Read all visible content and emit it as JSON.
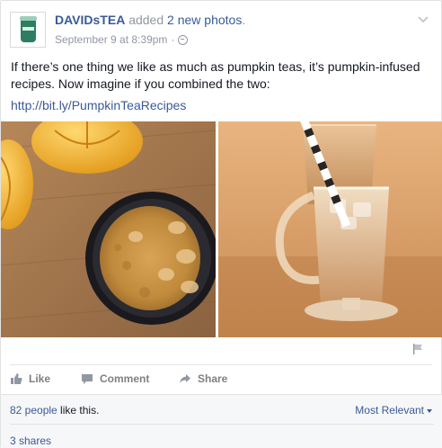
{
  "post": {
    "page_name": "DAVIDsTEA",
    "action_prefix": " added ",
    "photos_link": "2 new photos",
    "action_suffix": ".",
    "timestamp": "September 9 at 8:39pm",
    "separator": "·",
    "privacy_icon": "globe-icon",
    "menu_icon": "chevron-down-icon",
    "text": "If there’s one thing we like as much as pumpkin teas, it’s pumpkin-infused recipes. Now imagine if you combined the two:",
    "link": "http://bit.ly/PumpkinTeaRecipes",
    "photos": [
      {
        "subject": "pumpkin oatmeal bowl"
      },
      {
        "subject": "iced pumpkin tea latte"
      }
    ]
  },
  "actions": {
    "like": "Like",
    "comment": "Comment",
    "share": "Share"
  },
  "summary": {
    "likes_link": "82 people",
    "likes_suffix": " like this.",
    "sort": "Most Relevant",
    "shares": "3 shares"
  },
  "colors": {
    "link": "#3b5998",
    "muted": "#9197a3",
    "brand_green": "#2e7d61"
  }
}
